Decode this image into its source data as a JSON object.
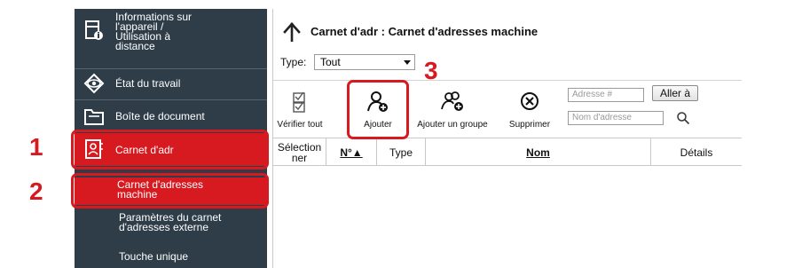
{
  "sidebar": {
    "items": [
      {
        "label": "Informations sur\nl'appareil /\nUtilisation à\ndistance",
        "icon": "device-info-icon"
      },
      {
        "label": "État du travail",
        "icon": "eye-icon"
      },
      {
        "label": "Boîte de document",
        "icon": "folder-icon"
      },
      {
        "label": "Carnet d'adr",
        "icon": "address-book-icon"
      }
    ],
    "subitems": [
      {
        "label": "Carnet d'adresses\nmachine"
      },
      {
        "label": "Paramètres du carnet\nd'adresses externe"
      },
      {
        "label": "Touche unique"
      }
    ]
  },
  "callouts": {
    "one": "1",
    "two": "2",
    "three": "3"
  },
  "main": {
    "title": "Carnet d'adr : Carnet d'adresses machine",
    "type_label": "Type:",
    "type_value": "Tout",
    "toolbar": {
      "check_all": "Vérifier tout",
      "add": "Ajouter",
      "add_group": "Ajouter un groupe",
      "delete": "Supprimer"
    },
    "address_number_placeholder": "Adresse #",
    "go_button": "Aller à",
    "address_name_placeholder": "Nom d'adresse",
    "columns": {
      "selection": "Sélection\nner",
      "number": "N°▲",
      "type": "Type",
      "name": "Nom",
      "details": "Détails"
    }
  },
  "colors": {
    "accent": "#d71920",
    "sidebar": "#2f3d49"
  }
}
